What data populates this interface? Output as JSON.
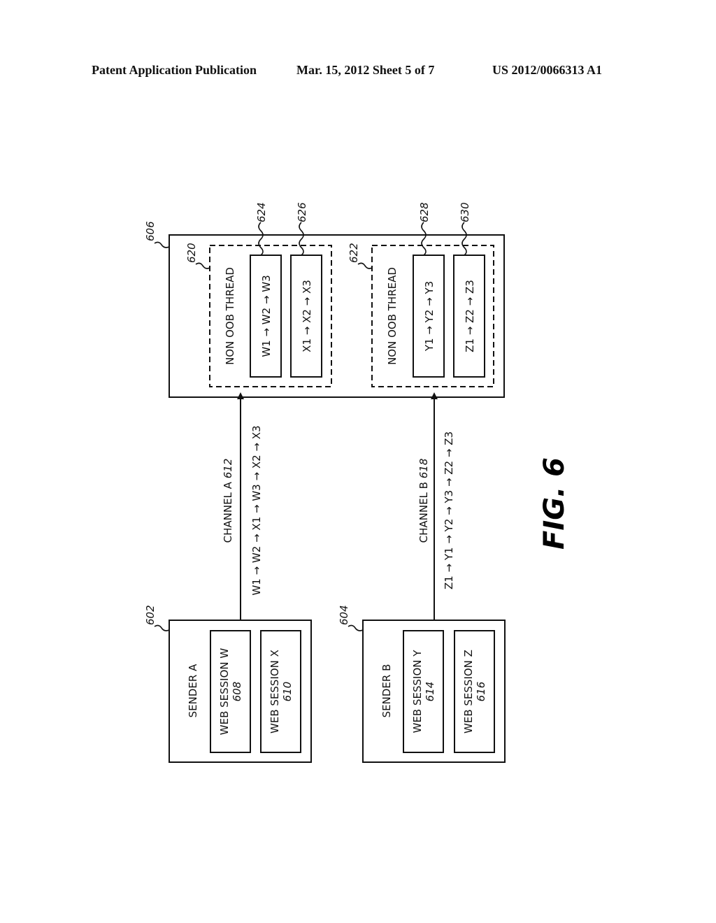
{
  "header": {
    "left": "Patent Application Publication",
    "middle": "Mar. 15, 2012  Sheet 5 of 7",
    "right": "US 2012/0066313 A1"
  },
  "figure_label": "FIG. 6",
  "receiver": {
    "ref": "606",
    "threads": [
      {
        "ref": "620",
        "label": "NON OOB THREAD",
        "queues": [
          {
            "ref": "624",
            "label": "W1 → W2 → W3"
          },
          {
            "ref": "626",
            "label": "X1 → X2 → X3"
          }
        ]
      },
      {
        "ref": "622",
        "label": "NON OOB THREAD",
        "queues": [
          {
            "ref": "628",
            "label": "Y1 → Y2 → Y3"
          },
          {
            "ref": "630",
            "label": "Z1 → Z2 → Z3"
          }
        ]
      }
    ]
  },
  "channels": [
    {
      "name": "CHANNEL A",
      "ref": "612",
      "sequence": "W1 → W2 → X1 → W3 → X2 → X3"
    },
    {
      "name": "CHANNEL B",
      "ref": "618",
      "sequence": "Z1 → Y1 → Y2 → Y3 → Z2 → Z3"
    }
  ],
  "senders": [
    {
      "ref": "602",
      "label": "SENDER A",
      "sessions": [
        {
          "label": "WEB SESSION W",
          "ref": "608"
        },
        {
          "label": "WEB SESSION X",
          "ref": "610"
        }
      ]
    },
    {
      "ref": "604",
      "label": "SENDER B",
      "sessions": [
        {
          "label": "WEB SESSION Y",
          "ref": "614"
        },
        {
          "label": "WEB SESSION Z",
          "ref": "616"
        }
      ]
    }
  ]
}
